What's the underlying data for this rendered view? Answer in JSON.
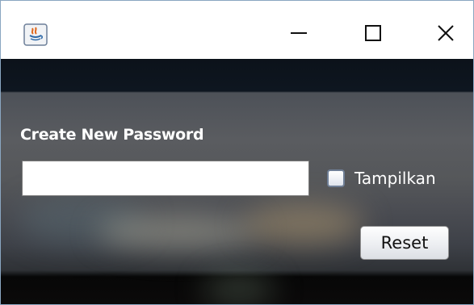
{
  "titlebar": {
    "app_icon": "java-icon",
    "controls": {
      "minimize": "minimize-icon",
      "maximize": "maximize-icon",
      "close": "close-icon"
    }
  },
  "form": {
    "heading": "Create New Password",
    "password_field": {
      "value": "",
      "placeholder": ""
    },
    "show_checkbox": {
      "label": "Tampilkan",
      "checked": false
    },
    "reset_button_label": "Reset"
  },
  "colors": {
    "window_border": "#8aa6c1",
    "text_on_background": "#ffffff"
  }
}
